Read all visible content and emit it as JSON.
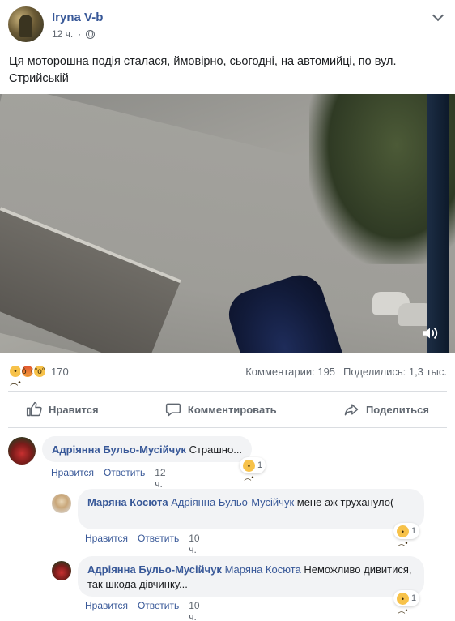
{
  "post": {
    "author": "Iryna V-b",
    "time": "12 ч.",
    "text": "Ця моторошна подія сталася, ймовірно, сьогодні, на автомийці, по вул. Стрийській",
    "icons": {
      "privacy": "globe-icon",
      "menu": "chevron-down-icon",
      "sound": "volume-icon"
    }
  },
  "stats": {
    "reaction_count": "170",
    "comments": "Комментарии: 195",
    "shares": "Поделились: 1,3 тыс."
  },
  "actions": {
    "like": "Нравится",
    "comment": "Комментировать",
    "share": "Поделиться"
  },
  "comments": [
    {
      "author": "Адріянна Бульо-Мусійчук",
      "mention": "",
      "text": "Страшно...",
      "like": "Нравится",
      "reply": "Ответить",
      "time": "12 ч.",
      "reactions": "1"
    },
    {
      "author": "Маряна Косюта",
      "mention": "Адріянна Бульо-Мусійчук",
      "text": "мене аж трухануло(",
      "like": "Нравится",
      "reply": "Ответить",
      "time": "10 ч.",
      "reactions": "1"
    },
    {
      "author": "Адріянна Бульо-Мусійчук",
      "mention": "Маряна Косюта",
      "text": "Неможливо дивитися, так шкода дівчинку...",
      "like": "Нравится",
      "reply": "Ответить",
      "time": "10 ч.",
      "reactions": "1"
    }
  ],
  "colors": {
    "link": "#385898",
    "muted": "#606770",
    "bubble": "#f2f3f5"
  }
}
